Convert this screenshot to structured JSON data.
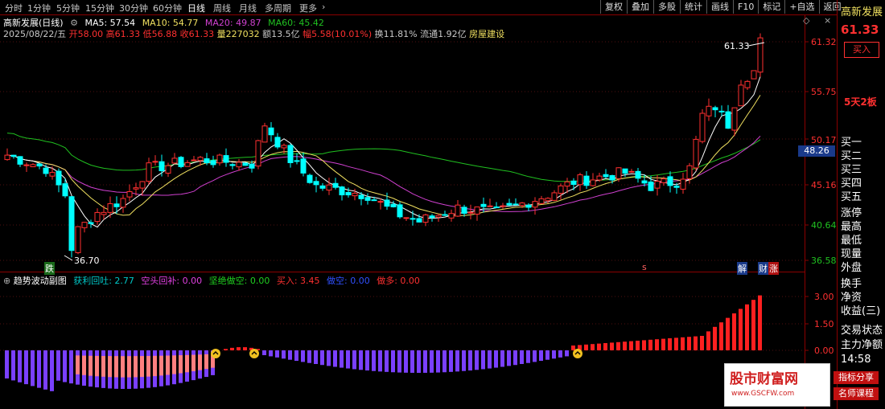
{
  "topbar": {
    "timeframes": [
      "分时",
      "1分钟",
      "5分钟",
      "15分钟",
      "30分钟",
      "60分钟",
      "日线",
      "周线",
      "月线",
      "多周期",
      "更多"
    ],
    "active": "日线",
    "toolbar": [
      "复权",
      "叠加",
      "多股",
      "统计",
      "画线",
      "F10",
      "标记",
      "+自选",
      "返回"
    ]
  },
  "header": {
    "title": "高新发展(日线)",
    "ma5": "MA5: 57.54",
    "ma10": "MA10: 54.77",
    "ma20": "MA20: 49.87",
    "ma60": "MA60: 45.42",
    "date": "2025/08/22/五",
    "open": "开58.00",
    "high": "高61.33",
    "low": "低56.88",
    "close": "收61.33",
    "volume": "量227032",
    "amount": "额13.5亿",
    "change": "幅5.58(10.01%)",
    "turnover": "换11.81%",
    "float": "流通1.92亿",
    "sector": "房屋建设"
  },
  "price_axis": [
    "61.32",
    "55.75",
    "50.17",
    "45.16",
    "40.64",
    "36.58"
  ],
  "current_price_tag": "48.26",
  "annotations": {
    "high_label": "61.33",
    "low_label": "36.70",
    "marker_die": "跌",
    "marker_s": "s",
    "marker_jie": "解",
    "marker_cai": "财",
    "marker_zhang": "涨"
  },
  "indicator": {
    "name": "趋势波动副图",
    "items": [
      {
        "label": "获利回吐: 2.77",
        "color": "#00c8c8"
      },
      {
        "label": "空头回补: 0.00",
        "color": "#e040e0"
      },
      {
        "label": "坚绝做空: 0.00",
        "color": "#20d020"
      },
      {
        "label": "买入: 3.45",
        "color": "#ff3030"
      },
      {
        "label": "做空: 0.00",
        "color": "#3050ff"
      },
      {
        "label": "做多: 0.00",
        "color": "#ff3030"
      }
    ],
    "axis": [
      "3.00",
      "1.50",
      "0.00"
    ]
  },
  "right_panel": {
    "name": "高新发展",
    "price": "61.33",
    "buy_btn": "买入",
    "streak": "5天2板",
    "rows": [
      "买一",
      "买二",
      "买三",
      "买四",
      "买五",
      "涨停",
      "最高",
      "最低",
      "现量",
      "外盘",
      "换手",
      "净资",
      "收益(三)",
      "交易状态",
      "主力净额"
    ],
    "time": "14:58"
  },
  "logo": {
    "main": "股市财富网",
    "sub": "www.GSCFW.com",
    "tag1": "指标分享",
    "tag2": "名师课程"
  },
  "colors": {
    "up": "#ff3030",
    "down": "#00ffff",
    "ma5": "#ffffff",
    "ma10": "#f0e060",
    "ma20": "#d040d0",
    "ma60": "#20c020"
  }
}
